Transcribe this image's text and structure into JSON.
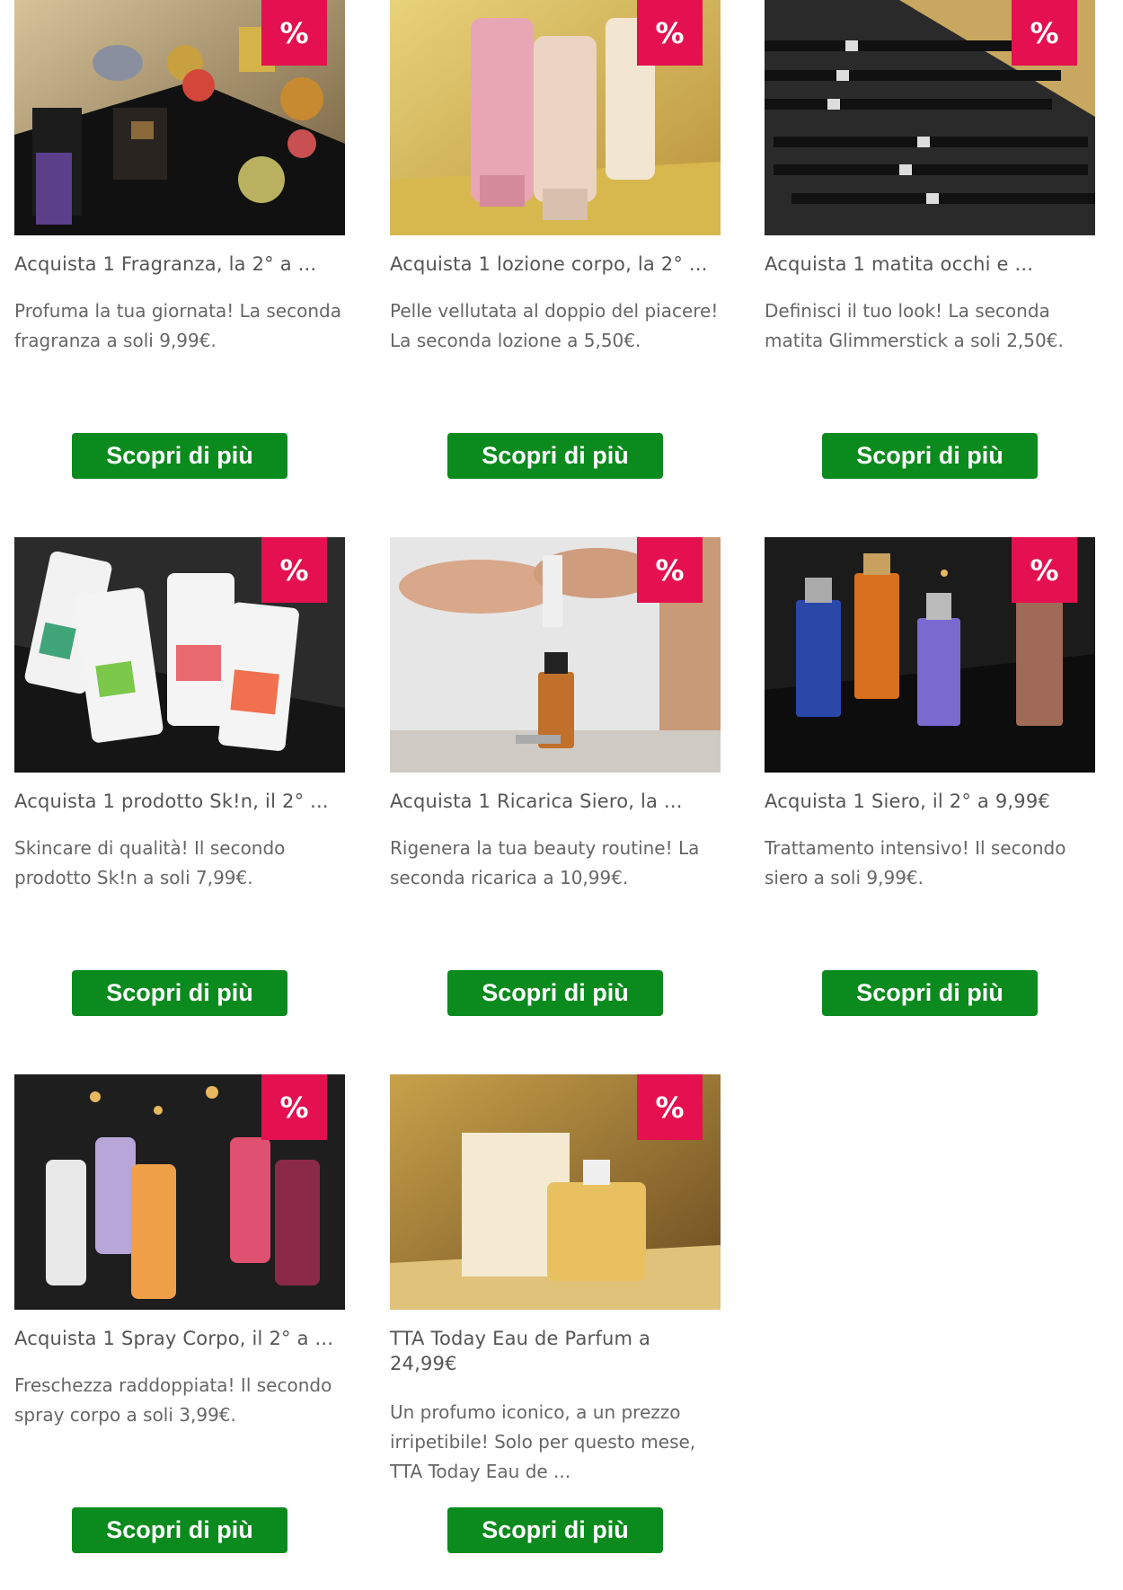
{
  "badge_symbol": "%",
  "accent_color": "#e4104f",
  "button_color": "#0b8a1e",
  "cards": [
    {
      "title": "Acquista 1 Fragranza, la 2° a ...",
      "desc": "Profuma la tua giornata! La seconda fragranza a soli 9,99€.",
      "button": "Scopri di più",
      "image": "fragrance-bottles-image"
    },
    {
      "title": "Acquista 1 lozione corpo, la 2° ...",
      "desc": "Pelle vellutata al doppio del piacere! La seconda lozione a 5,50€.",
      "button": "Scopri di più",
      "image": "body-lotion-tubes-image"
    },
    {
      "title": "Acquista 1 matita occhi e ...",
      "desc": "Definisci il tuo look! La seconda matita Glimmerstick a soli 2,50€.",
      "button": "Scopri di più",
      "image": "eye-pencils-image"
    },
    {
      "title": "Acquista 1 prodotto Sk!n, il 2° ...",
      "desc": "Skincare di qualità! Il secondo prodotto Sk!n a soli 7,99€.",
      "button": "Scopri di più",
      "image": "skin-cream-tubes-image"
    },
    {
      "title": "Acquista 1 Ricarica Siero, la ...",
      "desc": "Rigenera la tua beauty routine! La seconda ricarica a 10,99€.",
      "button": "Scopri di più",
      "image": "serum-refill-image"
    },
    {
      "title": "Acquista 1 Siero, il 2° a 9,99€",
      "desc": "Trattamento intensivo! Il secondo siero a soli 9,99€.",
      "button": "Scopri di più",
      "image": "serum-bottles-image"
    },
    {
      "title": "Acquista 1 Spray Corpo, il 2° a ...",
      "desc": "Freschezza raddoppiata! Il secondo spray corpo a soli 3,99€.",
      "button": "Scopri di più",
      "image": "body-spray-image"
    },
    {
      "title": "TTA Today Eau de Parfum a 24,99€",
      "desc": "Un profumo iconico, a un prezzo irripetibile! Solo per questo mese, TTA Today Eau de ...",
      "button": "Scopri di più",
      "image": "tta-today-perfume-image"
    }
  ]
}
